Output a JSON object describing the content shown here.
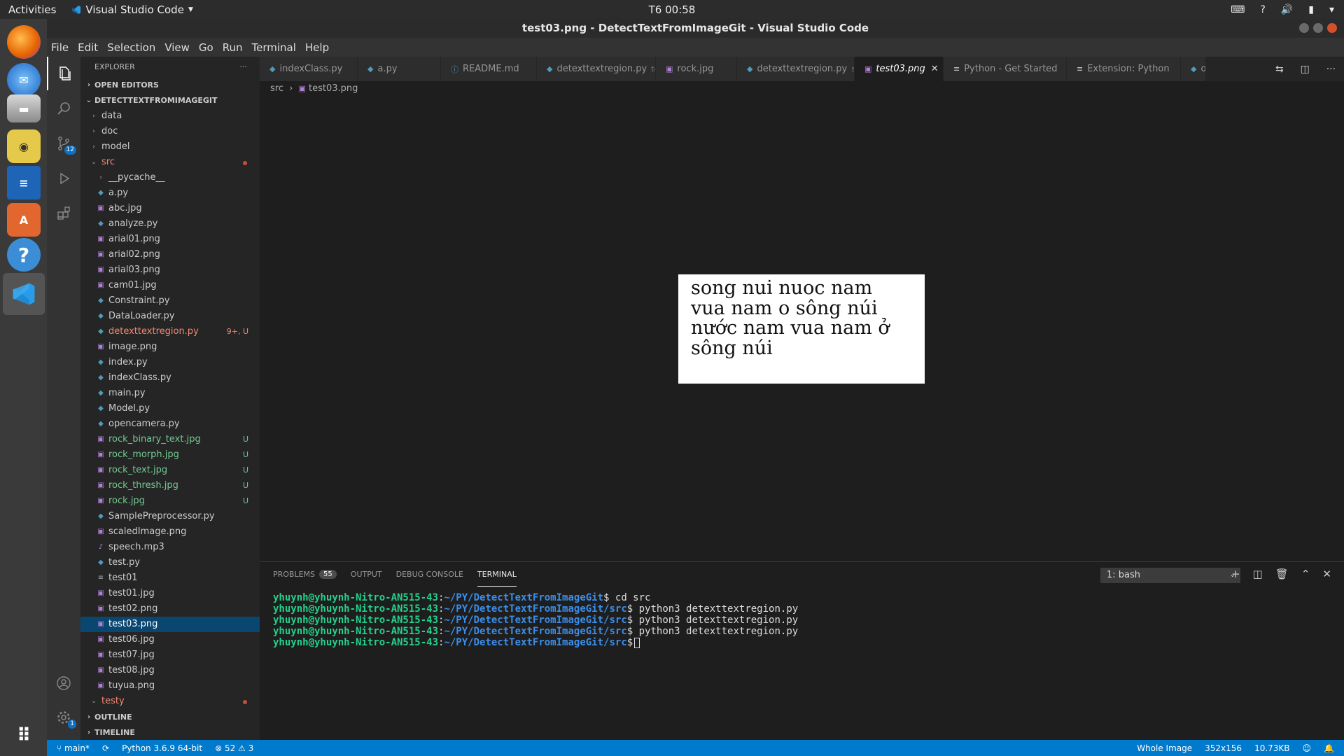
{
  "topbar": {
    "activities": "Activities",
    "app_name": "Visual Studio Code",
    "clock": "T6 00:58"
  },
  "window": {
    "title": "test03.png - DetectTextFromImageGit - Visual Studio Code"
  },
  "menu": [
    "File",
    "Edit",
    "Selection",
    "View",
    "Go",
    "Run",
    "Terminal",
    "Help"
  ],
  "activity": {
    "scm_badge": "12",
    "settings_badge": "1"
  },
  "sidebar": {
    "header": "EXPLORER",
    "dots": "···",
    "open_editors": "OPEN EDITORS",
    "project": "DETECTTEXTFROMIMAGEGIT",
    "outline": "OUTLINE",
    "timeline": "TIMELINE",
    "tree": [
      {
        "name": "data",
        "type": "folder",
        "depth": 0
      },
      {
        "name": "doc",
        "type": "folder",
        "depth": 0
      },
      {
        "name": "model",
        "type": "folder",
        "depth": 0
      },
      {
        "name": "src",
        "type": "folder-open",
        "depth": 0,
        "status": "dot",
        "color": "#f48771"
      },
      {
        "name": "__pycache__",
        "type": "folder",
        "depth": 1
      },
      {
        "name": "a.py",
        "type": "py",
        "depth": 1
      },
      {
        "name": "abc.jpg",
        "type": "img",
        "depth": 1
      },
      {
        "name": "analyze.py",
        "type": "py",
        "depth": 1
      },
      {
        "name": "arial01.png",
        "type": "img",
        "depth": 1
      },
      {
        "name": "arial02.png",
        "type": "img",
        "depth": 1
      },
      {
        "name": "arial03.png",
        "type": "img",
        "depth": 1
      },
      {
        "name": "cam01.jpg",
        "type": "img",
        "depth": 1
      },
      {
        "name": "Constraint.py",
        "type": "py",
        "depth": 1
      },
      {
        "name": "DataLoader.py",
        "type": "py",
        "depth": 1
      },
      {
        "name": "detexttextregion.py",
        "type": "py",
        "depth": 1,
        "status": "9+, U",
        "color": "#f48771"
      },
      {
        "name": "image.png",
        "type": "img",
        "depth": 1
      },
      {
        "name": "index.py",
        "type": "py",
        "depth": 1
      },
      {
        "name": "indexClass.py",
        "type": "py",
        "depth": 1
      },
      {
        "name": "main.py",
        "type": "py",
        "depth": 1
      },
      {
        "name": "Model.py",
        "type": "py",
        "depth": 1
      },
      {
        "name": "opencamera.py",
        "type": "py",
        "depth": 1
      },
      {
        "name": "rock_binary_text.jpg",
        "type": "img",
        "depth": 1,
        "status": "U",
        "color": "#73c991"
      },
      {
        "name": "rock_morph.jpg",
        "type": "img",
        "depth": 1,
        "status": "U",
        "color": "#73c991"
      },
      {
        "name": "rock_text.jpg",
        "type": "img",
        "depth": 1,
        "status": "U",
        "color": "#73c991"
      },
      {
        "name": "rock_thresh.jpg",
        "type": "img",
        "depth": 1,
        "status": "U",
        "color": "#73c991"
      },
      {
        "name": "rock.jpg",
        "type": "img",
        "depth": 1,
        "status": "U",
        "color": "#73c991"
      },
      {
        "name": "SamplePreprocessor.py",
        "type": "py",
        "depth": 1
      },
      {
        "name": "scaledImage.png",
        "type": "img",
        "depth": 1
      },
      {
        "name": "speech.mp3",
        "type": "audio",
        "depth": 1
      },
      {
        "name": "test.py",
        "type": "py",
        "depth": 1
      },
      {
        "name": "test01",
        "type": "txt",
        "depth": 1
      },
      {
        "name": "test01.jpg",
        "type": "img",
        "depth": 1
      },
      {
        "name": "test02.png",
        "type": "img",
        "depth": 1
      },
      {
        "name": "test03.png",
        "type": "img",
        "depth": 1,
        "selected": true
      },
      {
        "name": "test06.jpg",
        "type": "img",
        "depth": 1
      },
      {
        "name": "test07.jpg",
        "type": "img",
        "depth": 1
      },
      {
        "name": "test08.jpg",
        "type": "img",
        "depth": 1
      },
      {
        "name": "tuyua.png",
        "type": "img",
        "depth": 1
      },
      {
        "name": "testy",
        "type": "folder-open",
        "depth": 0,
        "status": "dot",
        "color": "#f48771"
      }
    ]
  },
  "tabs": [
    {
      "label": "indexClass.py",
      "icon": "py",
      "width": 140
    },
    {
      "label": "a.py",
      "icon": "py",
      "width": 119
    },
    {
      "label": "README.md",
      "icon": "info",
      "width": 137
    },
    {
      "label": "detexttextregion.py",
      "sub": "testy",
      "icon": "py",
      "width": 170
    },
    {
      "label": "rock.jpg",
      "icon": "img",
      "width": 116
    },
    {
      "label": "detexttextregion.py",
      "sub": "src",
      "icon": "py",
      "width": 168
    },
    {
      "label": "test03.png",
      "icon": "img",
      "active": true,
      "width": 127
    },
    {
      "label": "Python - Get Started",
      "icon": "doc",
      "width": 176
    },
    {
      "label": "Extension: Python",
      "icon": "doc",
      "width": 163
    },
    {
      "label": "o",
      "icon": "py",
      "width": 36
    }
  ],
  "breadcrumb": {
    "folder": "src",
    "file": "test03.png"
  },
  "image_text": [
    "song nui nuoc nam",
    "vua nam o sông núi",
    "nước nam vua nam ở",
    "sông núi"
  ],
  "panel": {
    "tabs": [
      "PROBLEMS",
      "OUTPUT",
      "DEBUG CONSOLE",
      "TERMINAL"
    ],
    "problem_count": "55",
    "terminal_select": "1: bash"
  },
  "terminal": [
    {
      "user": "yhuynh@yhuynh-Nitro-AN515-43",
      "path": "~/PY/DetectTextFromImageGit",
      "cmd": "$ cd src"
    },
    {
      "user": "yhuynh@yhuynh-Nitro-AN515-43",
      "path": "~/PY/DetectTextFromImageGit/src",
      "cmd": "$ python3 detexttextregion.py"
    },
    {
      "user": "yhuynh@yhuynh-Nitro-AN515-43",
      "path": "~/PY/DetectTextFromImageGit/src",
      "cmd": "$ python3 detexttextregion.py"
    },
    {
      "user": "yhuynh@yhuynh-Nitro-AN515-43",
      "path": "~/PY/DetectTextFromImageGit/src",
      "cmd": "$ python3 detexttextregion.py"
    },
    {
      "user": "yhuynh@yhuynh-Nitro-AN515-43",
      "path": "~/PY/DetectTextFromImageGit/src",
      "cmd": "$",
      "cursor": true
    }
  ],
  "status": {
    "branch": "main*",
    "python": "Python 3.6.9 64-bit",
    "errors": "52",
    "warnings": "3",
    "zoom": "Whole Image",
    "dims": "352x156",
    "size": "10.73KB"
  },
  "colors": {
    "accent": "#007acc",
    "untracked": "#73c991",
    "modified": "#f48771",
    "selected": "#094771"
  }
}
